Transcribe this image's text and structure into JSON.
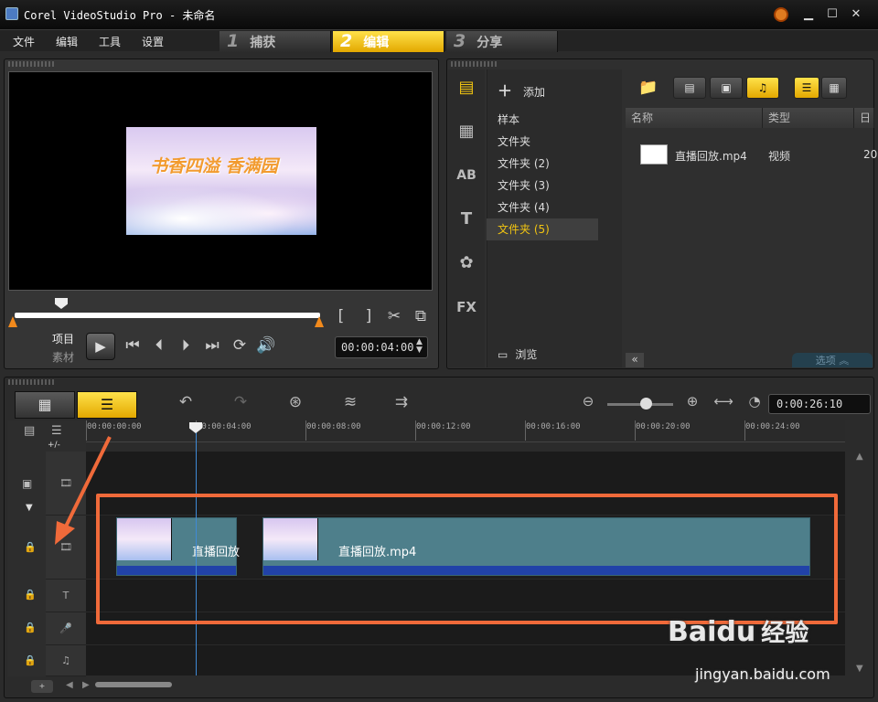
{
  "window": {
    "title": "Corel VideoStudio Pro - 未命名",
    "min": "▁",
    "max": "☐",
    "close": "✕"
  },
  "menu": {
    "items": [
      "文件",
      "编辑",
      "工具",
      "设置"
    ]
  },
  "steps": [
    {
      "num": "1",
      "label": "捕获",
      "active": false
    },
    {
      "num": "2",
      "label": "编辑",
      "active": true
    },
    {
      "num": "3",
      "label": "分享",
      "active": false
    }
  ],
  "player": {
    "overlay_text": "书香四溢 香满园",
    "mode_project": "项目",
    "mode_clip": "素材",
    "timecode": "00:00:04:00",
    "mark_in": "[",
    "mark_out": "]"
  },
  "library": {
    "add_label": "添加",
    "browse_label": "浏览",
    "items": [
      "样本",
      "文件夹",
      "文件夹 (2)",
      "文件夹 (3)",
      "文件夹 (4)",
      "文件夹 (5)"
    ],
    "selected_index": 5,
    "columns": [
      "名称",
      "类型",
      "日期"
    ],
    "files": [
      {
        "name": "直播回放.mp4",
        "type": "视频",
        "date": "20"
      }
    ],
    "options_label": "选项"
  },
  "timeline": {
    "duration": "0:00:26:10",
    "ticks": [
      "00:00:00:00",
      "00:00:04:00",
      "00:00:08:00",
      "00:00:12:00",
      "00:00:16:00",
      "00:00:20:00",
      "00:00:24:00"
    ],
    "add_track": "+/-",
    "clips": [
      {
        "name": "直播回放"
      },
      {
        "name": "直播回放.mp4"
      }
    ]
  },
  "watermark": {
    "text": "jingyan.baidu.com",
    "brand": "Baidu",
    "cn": "经验"
  },
  "colors": {
    "accent": "#f2c511",
    "annotation": "#f06a3a",
    "clip": "#4e7f8b",
    "audio": "#2142a8"
  }
}
